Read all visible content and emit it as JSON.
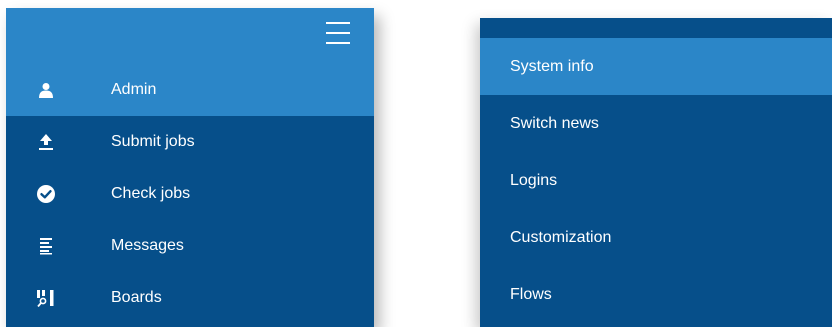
{
  "menu_icon": "hamburger-menu-icon",
  "colors": {
    "sidebar_bg": "#064f8a",
    "active_bg": "#2b86c8",
    "text": "#ffffff"
  },
  "left_menu": {
    "items": [
      {
        "label": "Admin",
        "icon": "user-icon",
        "active": true
      },
      {
        "label": "Submit jobs",
        "icon": "upload-icon",
        "active": false
      },
      {
        "label": "Check jobs",
        "icon": "check-circle-icon",
        "active": false
      },
      {
        "label": "Messages",
        "icon": "messages-icon",
        "active": false
      },
      {
        "label": "Boards",
        "icon": "boards-icon",
        "active": false
      }
    ]
  },
  "right_menu": {
    "items": [
      {
        "label": "System info",
        "active": true
      },
      {
        "label": "Switch news",
        "active": false
      },
      {
        "label": "Logins",
        "active": false
      },
      {
        "label": "Customization",
        "active": false
      },
      {
        "label": "Flows",
        "active": false
      }
    ]
  }
}
